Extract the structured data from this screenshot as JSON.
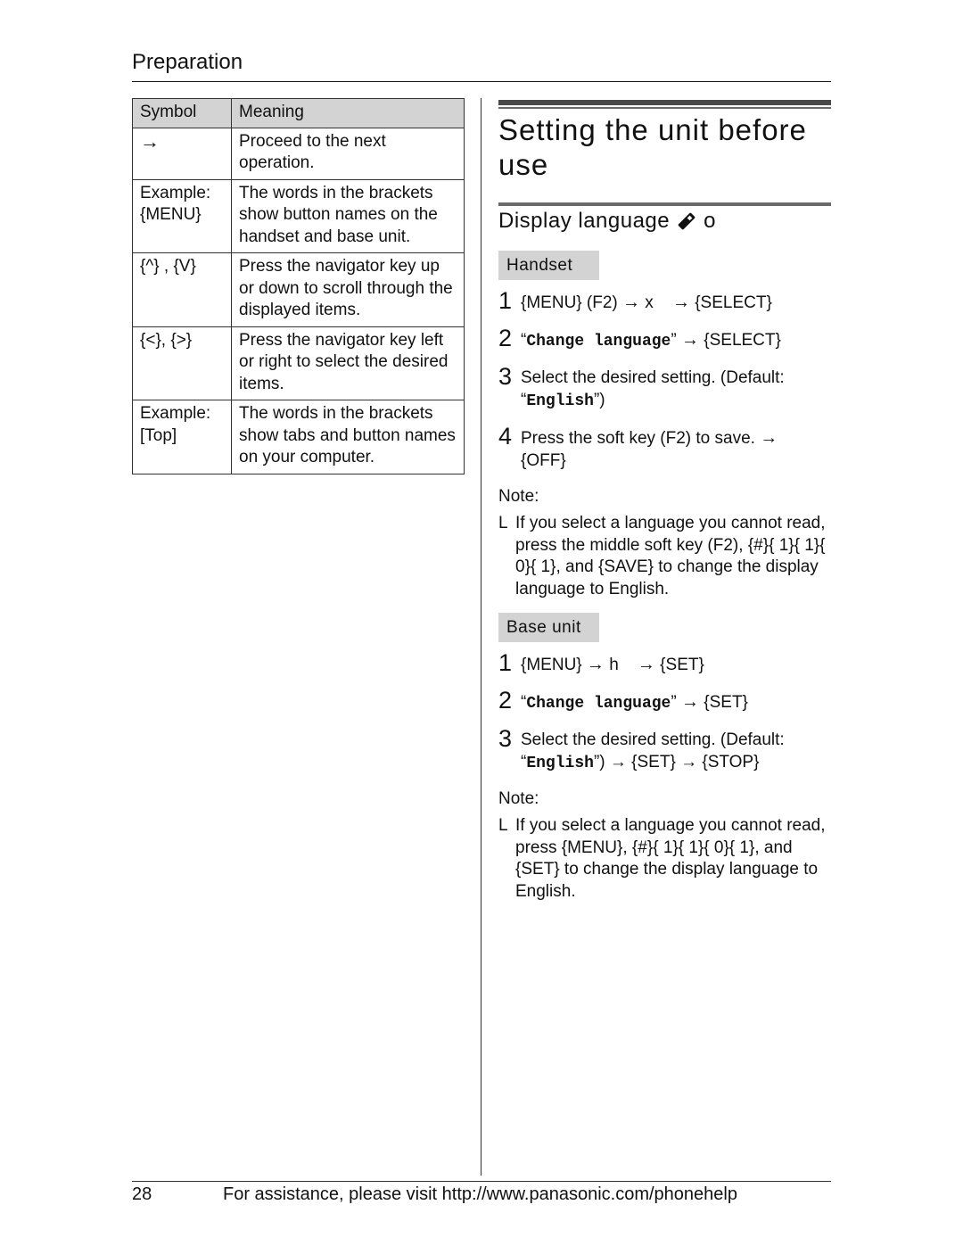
{
  "header": {
    "section": "Preparation"
  },
  "table": {
    "headers": [
      "Symbol",
      "Meaning"
    ],
    "rows": [
      {
        "symbol": "→",
        "meaning": "Proceed to the next operation."
      },
      {
        "symbol": "Example: {MENU}",
        "meaning": "The words in the brackets show button names on the handset and base unit."
      },
      {
        "symbol": "{^} , {V}",
        "meaning": "Press the navigator key up or down to scroll through the displayed items."
      },
      {
        "symbol": "{<}, {>}",
        "meaning": "Press the navigator key left or right to select the desired items."
      },
      {
        "symbol": "Example: [Top]",
        "meaning": "The words in the brackets show tabs and button names on your computer."
      }
    ]
  },
  "main": {
    "title": "Setting the unit before use",
    "subtitle": "Display language",
    "subtitle_icons": [
      "handset-icon",
      "o"
    ],
    "handset": {
      "tag": "Handset",
      "steps": [
        {
          "num": "1",
          "parts": [
            "{MENU} (F2) ",
            "→",
            " x ",
            "→",
            " {SELECT}"
          ]
        },
        {
          "num": "2",
          "quoted": "Change language",
          "after": [
            "→",
            " {SELECT}"
          ]
        },
        {
          "num": "3",
          "text": "Select the desired setting. (Default:",
          "quoted": "English",
          "tail": ")"
        },
        {
          "num": "4",
          "text": "Press the soft key (F2) to save.",
          "arrow": "→",
          "tail": "{OFF}"
        }
      ],
      "note_label": "Note:",
      "note_bullet": "L",
      "note": "If you select a language you cannot read, press the middle soft key (F2), {#}{ 1}{ 1}{ 0}{ 1}, and {SAVE} to change the display language to English."
    },
    "base": {
      "tag": "Base unit",
      "steps": [
        {
          "num": "1",
          "parts": [
            "{MENU} ",
            "→",
            " h ",
            "→",
            " {SET}"
          ]
        },
        {
          "num": "2",
          "quoted": "Change language",
          "after": [
            "→",
            " {SET}"
          ]
        },
        {
          "num": "3",
          "text": "Select the desired setting. (Default:",
          "quoted": "English",
          "tail": ") → {SET} → {STOP}"
        }
      ],
      "note_label": "Note:",
      "note_bullet": "L",
      "note": "If you select a language you cannot read, press {MENU}, {#}{ 1}{ 1}{ 0}{ 1}, and {SET} to change the display language to English."
    }
  },
  "footer": {
    "page_number": "28",
    "text": "For assistance, please visit http://www.panasonic.com/phonehelp"
  }
}
